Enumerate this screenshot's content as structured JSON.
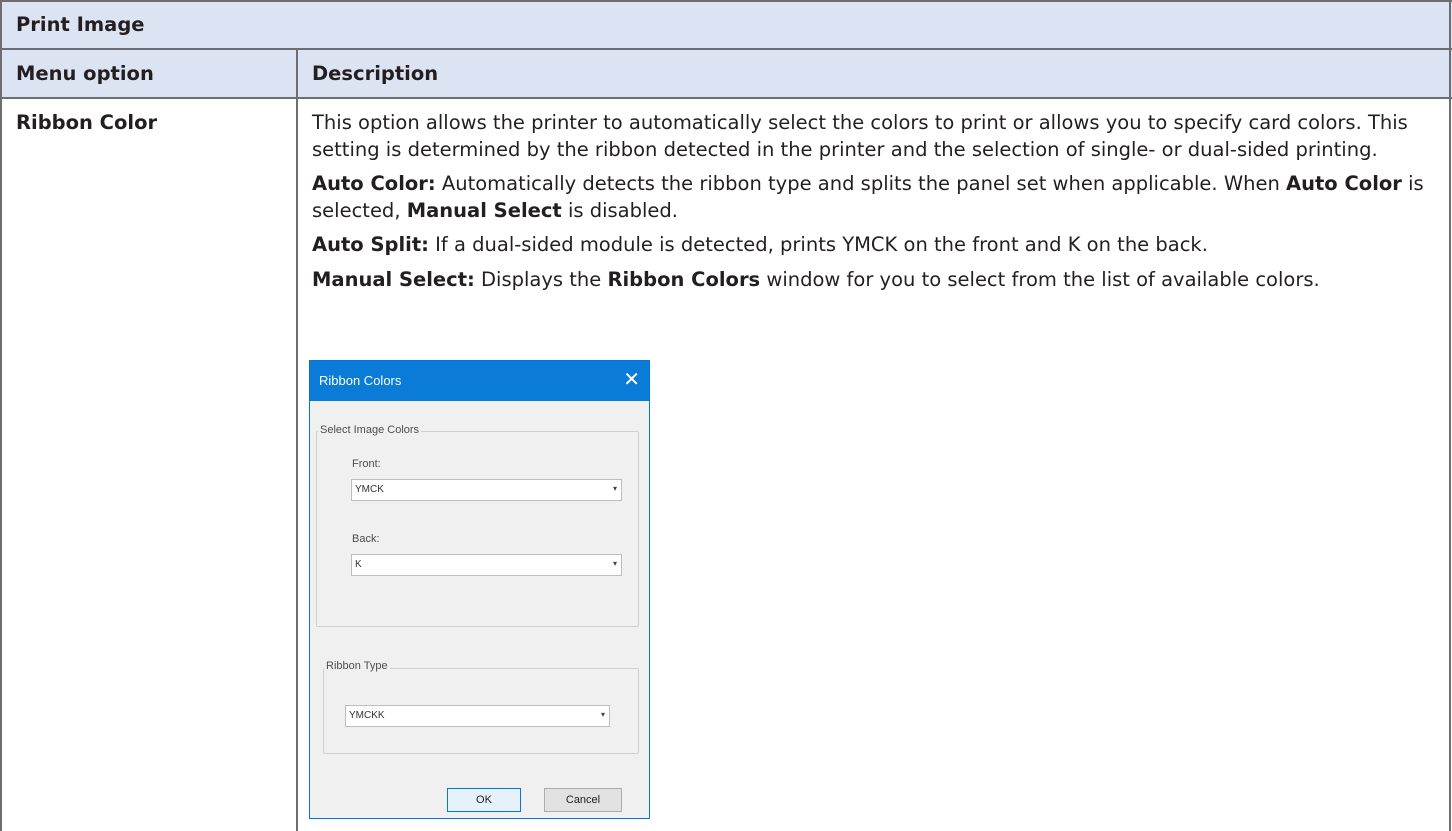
{
  "table": {
    "title": "Print Image",
    "col_menu": "Menu option",
    "col_desc": "Description",
    "row_option": "Ribbon Color",
    "para1": "This option allows the printer to automatically select the colors to print or allows you to specify card colors. This setting is determined by the ribbon detected in the printer and the selection of single- or dual-sided printing.",
    "auto_color_label": "Auto Color:",
    "auto_color_text1": " Automatically detects the ribbon type and splits the panel set when applicable. When ",
    "auto_color_bold1": "Auto Color",
    "auto_color_text2": " is selected, ",
    "auto_color_bold2": "Manual Select",
    "auto_color_text3": " is disabled.",
    "auto_split_label": "Auto Split:",
    "auto_split_text": " If a dual-sided module is detected, prints YMCK on the front and K on the back.",
    "manual_label": "Manual Select:",
    "manual_text1": " Displays the ",
    "manual_bold": "Ribbon Colors",
    "manual_text2": " window for you to select from the list of available colors."
  },
  "dialog": {
    "title": "Ribbon Colors",
    "close_glyph": "✕",
    "group_image_colors": "Select Image Colors",
    "front_label": "Front:",
    "front_value": "YMCK",
    "back_label": "Back:",
    "back_value": "K",
    "group_ribbon_type": "Ribbon Type",
    "ribbon_type_value": "YMCKK",
    "dropdown_glyph": "▾",
    "ok_label": "OK",
    "cancel_label": "Cancel"
  },
  "colors": {
    "header_fill": "#dce3f3",
    "border": "#6d6e71",
    "dialog_titlebar": "#0a7bd6"
  }
}
